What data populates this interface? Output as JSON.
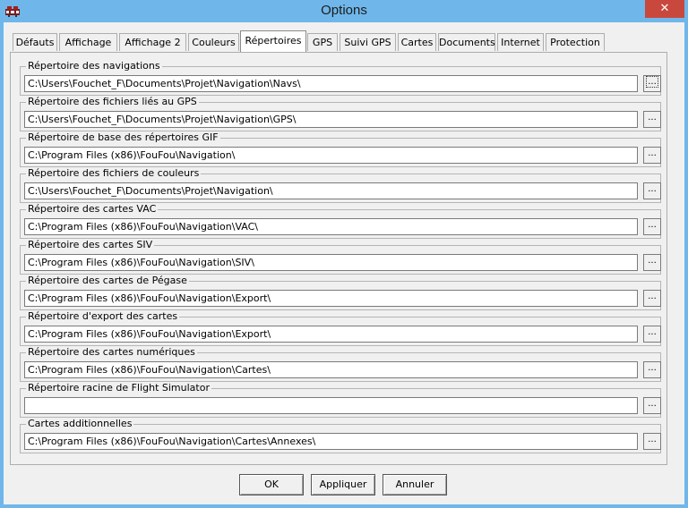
{
  "window": {
    "title": "Options",
    "close_label": "✕"
  },
  "tabs": [
    {
      "label": "Défauts"
    },
    {
      "label": "Affichage"
    },
    {
      "label": "Affichage 2"
    },
    {
      "label": "Couleurs"
    },
    {
      "label": "Répertoires"
    },
    {
      "label": "GPS"
    },
    {
      "label": "Suivi GPS"
    },
    {
      "label": "Cartes"
    },
    {
      "label": "Documents"
    },
    {
      "label": "Internet"
    },
    {
      "label": "Protection"
    }
  ],
  "active_tab": "Répertoires",
  "directories": [
    {
      "label": "Répertoire des navigations",
      "value": "C:\\Users\\Fouchet_F\\Documents\\Projet\\Navigation\\Navs\\"
    },
    {
      "label": "Répertoire des fichiers liés au GPS",
      "value": "C:\\Users\\Fouchet_F\\Documents\\Projet\\Navigation\\GPS\\"
    },
    {
      "label": "Répertoire de base des répertoires GIF",
      "value": "C:\\Program Files (x86)\\FouFou\\Navigation\\"
    },
    {
      "label": "Répertoire des fichiers de couleurs",
      "value": "C:\\Users\\Fouchet_F\\Documents\\Projet\\Navigation\\"
    },
    {
      "label": "Répertoire des cartes VAC",
      "value": "C:\\Program Files (x86)\\FouFou\\Navigation\\VAC\\"
    },
    {
      "label": "Répertoire des cartes SIV",
      "value": "C:\\Program Files (x86)\\FouFou\\Navigation\\SIV\\"
    },
    {
      "label": "Répertoire des cartes de Pégase",
      "value": "C:\\Program Files (x86)\\FouFou\\Navigation\\Export\\"
    },
    {
      "label": "Répertoire d'export des cartes",
      "value": "C:\\Program Files (x86)\\FouFou\\Navigation\\Export\\"
    },
    {
      "label": "Répertoire des cartes numériques",
      "value": "C:\\Program Files (x86)\\FouFou\\Navigation\\Cartes\\"
    },
    {
      "label": "Répertoire racine de Flight Simulator",
      "value": ""
    },
    {
      "label": "Cartes additionnelles",
      "value": "C:\\Program Files (x86)\\FouFou\\Navigation\\Cartes\\Annexes\\"
    }
  ],
  "browse_label": "...",
  "buttons": {
    "ok": "OK",
    "apply": "Appliquer",
    "cancel": "Annuler"
  },
  "colors": {
    "titlebar": "#6fb7ea",
    "close": "#c9483e",
    "window": "#f0f0f0"
  }
}
